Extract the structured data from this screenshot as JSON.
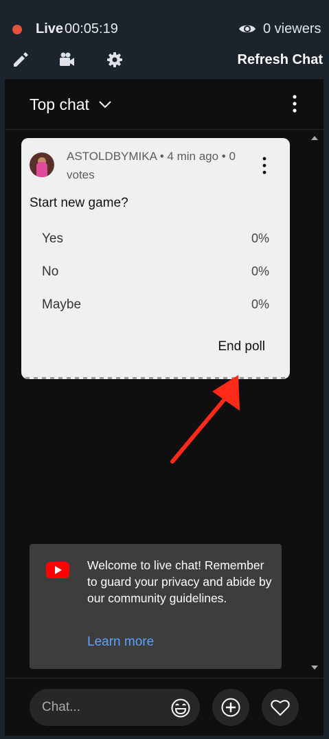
{
  "topbar": {
    "live_label": "Live",
    "elapsed": "00:05:19",
    "viewers": "0 viewers",
    "refresh_label": "Refresh Chat",
    "icons": [
      "pencil-icon",
      "camera-icon",
      "gear-icon",
      "eye-icon"
    ],
    "live_color": "#e5533c"
  },
  "chat": {
    "title": "Top chat",
    "icons": [
      "chevron-down-icon",
      "more-vert-icon"
    ]
  },
  "poll": {
    "meta": "ASTOLDBYMIKA • 4 min ago • 0 votes",
    "question": "Start new game?",
    "options": [
      {
        "label": "Yes",
        "percent": "0%"
      },
      {
        "label": "No",
        "percent": "0%"
      },
      {
        "label": "Maybe",
        "percent": "0%"
      }
    ],
    "end_label": "End poll"
  },
  "welcome": {
    "text": "Welcome to live chat! Remember to guard your privacy and abide by our community guidelines.",
    "link": "Learn more",
    "link_color": "#5ea1ff"
  },
  "composer": {
    "placeholder": "Chat...",
    "icons": [
      "emoji-icon",
      "add-icon",
      "heart-icon"
    ]
  },
  "annotation": {
    "arrow_color": "#ff2a1a"
  }
}
